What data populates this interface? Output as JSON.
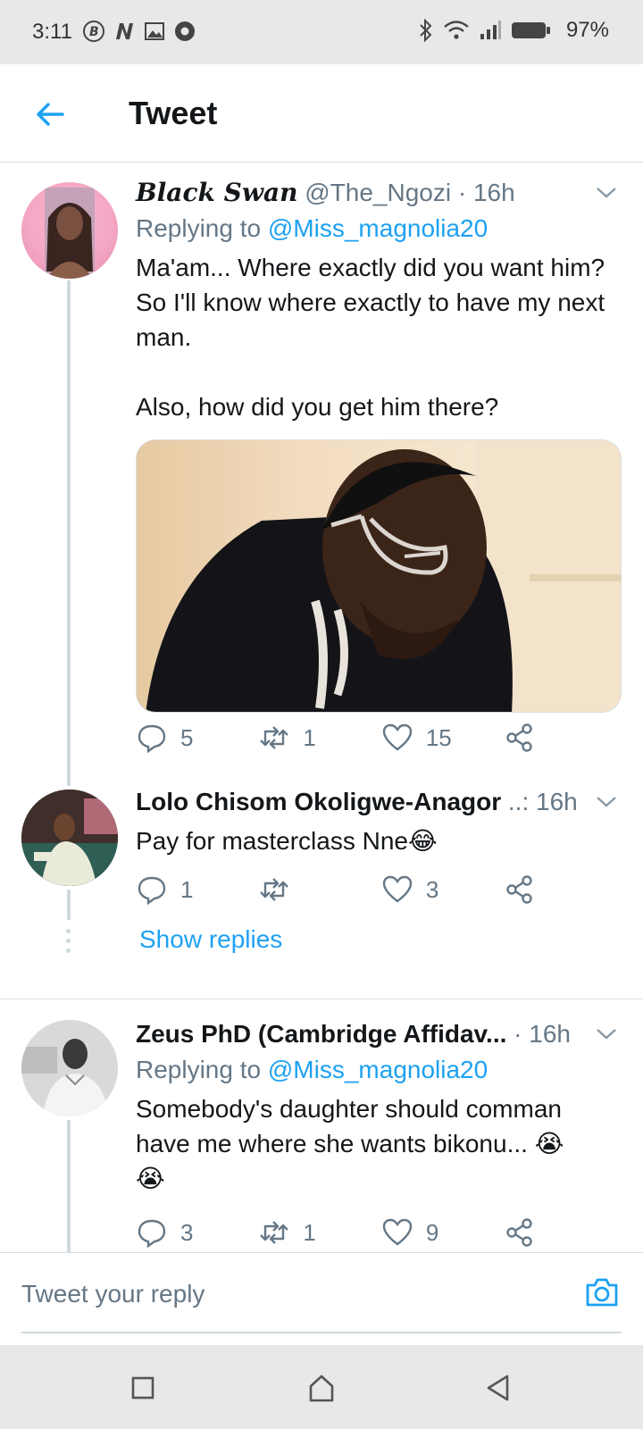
{
  "status_bar": {
    "time": "3:11",
    "battery_percent": "97%",
    "icons_left": [
      "b-circle-icon",
      "n-icon",
      "image-icon",
      "chrome-icon"
    ],
    "icons_right": [
      "bluetooth-icon",
      "wifi-icon",
      "signal-icon",
      "battery-icon"
    ]
  },
  "header": {
    "title": "Tweet",
    "back_icon": "arrow-left-icon"
  },
  "tweets": [
    {
      "name": "Black Swan",
      "handle": "@The_Ngozi",
      "sep": "·",
      "time": "16h",
      "replying_label": "Replying to",
      "replying_to": "@Miss_magnolia20",
      "text": "Ma'am... Where exactly did you want him? So I'll know where exactly to have my next man.\n\nAlso, how did you get him there?",
      "replies": "5",
      "retweets": "1",
      "likes": "15"
    },
    {
      "name": "Lolo Chisom Okoligwe-Anagor",
      "handle": "..:",
      "time": "16h",
      "text": "Pay for masterclass Nne😂",
      "replies": "1",
      "retweets": "",
      "likes": "3",
      "show_replies": "Show replies"
    },
    {
      "name": "Zeus PhD (Cambridge Affidav...",
      "sep": "·",
      "time": "16h",
      "replying_label": "Replying to",
      "replying_to": "@Miss_magnolia20",
      "text": "Somebody's daughter should comman have me where she wants bikonu... 😭\n😭",
      "replies": "3",
      "retweets": "1",
      "likes": "9"
    }
  ],
  "reply_bar": {
    "placeholder": "Tweet your reply",
    "camera_icon": "camera-icon"
  },
  "colors": {
    "accent": "#1da1f2",
    "secondary_text": "#657786",
    "primary_text": "#14171a",
    "divider": "#d8dde0"
  }
}
